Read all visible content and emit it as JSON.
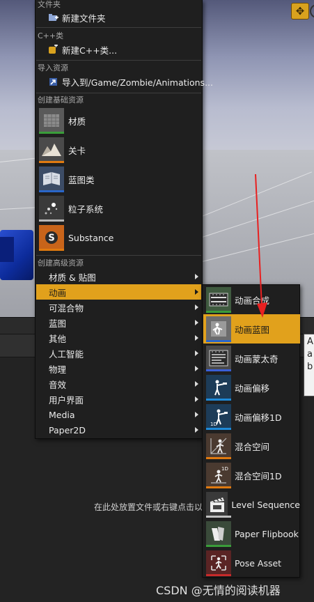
{
  "menu": {
    "sections": {
      "folder": "文件夹",
      "cpp": "C++类",
      "import": "导入资源",
      "basic": "创建基础资源",
      "advanced": "创建高级资源"
    },
    "new_folder": "新建文件夹",
    "new_cpp": "新建C++类...",
    "import_to": "导入到/Game/Zombie/Animations...",
    "basic_assets": [
      {
        "label": "材质",
        "icon": "material-icon",
        "color": "#3a9d3a"
      },
      {
        "label": "关卡",
        "icon": "level-icon",
        "color": "#e07a10"
      },
      {
        "label": "蓝图类",
        "icon": "blueprint-icon",
        "color": "#2a66c8"
      },
      {
        "label": "粒子系统",
        "icon": "particle-icon",
        "color": "#b8b8b8"
      },
      {
        "label": "Substance",
        "icon": "substance-icon",
        "color": "#e07a10"
      }
    ],
    "advanced_items": [
      {
        "label": "材质 & 贴图",
        "active": false
      },
      {
        "label": "动画",
        "active": true
      },
      {
        "label": "可混合物",
        "active": false
      },
      {
        "label": "蓝图",
        "active": false
      },
      {
        "label": "其他",
        "active": false
      },
      {
        "label": "人工智能",
        "active": false
      },
      {
        "label": "物理",
        "active": false
      },
      {
        "label": "音效",
        "active": false
      },
      {
        "label": "用户界面",
        "active": false
      },
      {
        "label": "Media",
        "active": false
      },
      {
        "label": "Paper2D",
        "active": false
      }
    ]
  },
  "submenu": {
    "items": [
      {
        "label": "动画合成",
        "icon": "anim-composite-icon",
        "color": "#3a9d3a",
        "active": false
      },
      {
        "label": "动画蓝图",
        "icon": "anim-blueprint-icon",
        "color": "#2a66c8",
        "active": true
      },
      {
        "label": "动画蒙太奇",
        "icon": "anim-montage-icon",
        "color": "#3a5fd8",
        "active": false
      },
      {
        "label": "动画偏移",
        "icon": "aim-offset-icon",
        "color": "#1e8ad8",
        "active": false
      },
      {
        "label": "动画偏移1D",
        "icon": "aim-offset-1d-icon",
        "color": "#1e8ad8",
        "active": false
      },
      {
        "label": "混合空间",
        "icon": "blend-space-icon",
        "color": "#e07a10",
        "active": false
      },
      {
        "label": "混合空间1D",
        "icon": "blend-space-1d-icon",
        "color": "#e07a10",
        "active": false
      },
      {
        "label": "Level Sequence",
        "icon": "level-sequence-icon",
        "color": "#c0c0c0",
        "active": false
      },
      {
        "label": "Paper Flipbook",
        "icon": "paper-flipbook-icon",
        "color": "#3a9d3a",
        "active": false
      },
      {
        "label": "Pose Asset",
        "icon": "pose-asset-icon",
        "color": "#c82a2a",
        "active": false
      }
    ]
  },
  "drop_hint": "在此处放置文件或右键点击以",
  "tooltip_text": "A a b",
  "watermark": "CSDN @无情的阅读机器",
  "accent_color": "#e1a11c"
}
